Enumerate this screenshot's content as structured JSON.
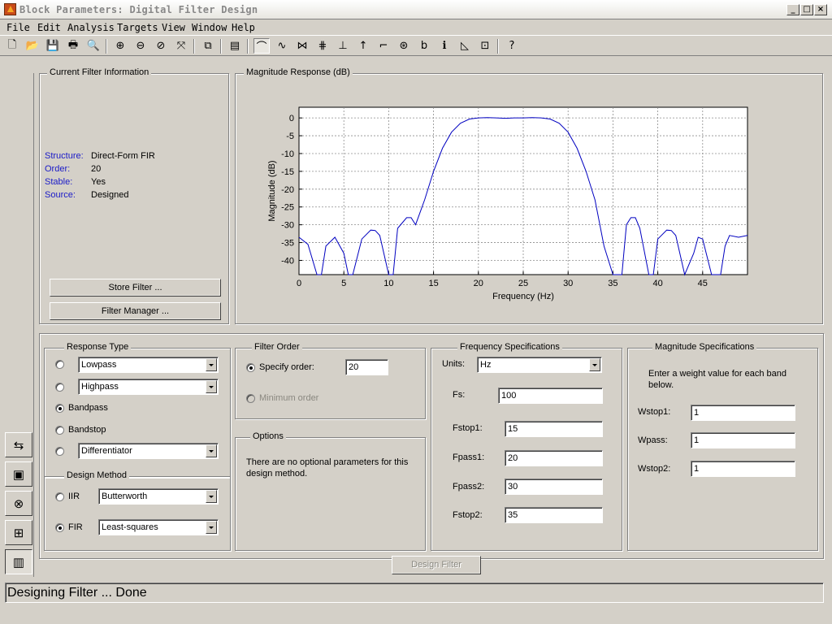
{
  "window": {
    "title": "Block Parameters: Digital Filter Design"
  },
  "menu": [
    "File",
    "Edit",
    "Analysis",
    "Targets",
    "View",
    "Window",
    "Help"
  ],
  "filter_info": {
    "title": "Current Filter Information",
    "structure_label": "Structure:",
    "structure": "Direct-Form FIR",
    "order_label": "Order:",
    "order": "20",
    "stable_label": "Stable:",
    "stable": "Yes",
    "source_label": "Source:",
    "source": "Designed",
    "store_button": "Store Filter ...",
    "manager_button": "Filter Manager ..."
  },
  "response_panel": {
    "title": "Magnitude Response (dB)"
  },
  "chart_data": {
    "type": "line",
    "xlabel": "Frequency (Hz)",
    "ylabel": "Magnitude (dB)",
    "xlim": [
      0,
      50
    ],
    "ylim": [
      -44,
      3
    ],
    "xticks": [
      0,
      5,
      10,
      15,
      20,
      25,
      30,
      35,
      40,
      45
    ],
    "yticks": [
      0,
      -5,
      -10,
      -15,
      -20,
      -25,
      -30,
      -35,
      -40
    ],
    "grid": true,
    "line_color": "#0000c0",
    "series": [
      {
        "x": [
          0,
          1,
          2,
          2.5,
          3,
          4,
          5,
          5.5,
          6,
          7,
          8,
          8.5,
          9,
          10,
          10.5,
          11,
          12,
          12.5,
          13,
          14,
          15,
          16,
          17,
          18,
          19,
          20,
          21,
          22,
          23,
          24,
          25,
          26,
          27,
          28,
          29,
          30,
          31,
          32,
          33,
          34,
          35,
          36,
          36.5,
          37,
          37.5,
          38,
          39,
          39.5,
          40,
          41,
          41.5,
          42,
          43,
          44,
          44.5,
          45,
          46,
          47,
          47.5,
          48,
          49,
          50
        ],
        "y": [
          -33.5,
          -35.5,
          -44,
          -44,
          -36,
          -33.5,
          -38,
          -44,
          -44,
          -34,
          -31.5,
          -31.6,
          -33,
          -44,
          -44,
          -31,
          -28,
          -28,
          -30,
          -23,
          -15,
          -8.5,
          -4,
          -1.5,
          -0.3,
          0,
          0.1,
          0,
          -0.1,
          0,
          0,
          0.1,
          0,
          -0.3,
          -1.5,
          -4,
          -8.5,
          -15,
          -23,
          -36,
          -44,
          -44,
          -30,
          -28,
          -28,
          -31,
          -44,
          -44,
          -34,
          -31.5,
          -31.6,
          -33,
          -44,
          -38,
          -33.5,
          -34,
          -44,
          -44,
          -36,
          -33,
          -33.5,
          -33
        ]
      }
    ]
  },
  "response_type": {
    "title": "Response Type",
    "options": [
      "Lowpass",
      "Highpass",
      "Bandpass",
      "Bandstop",
      "Differentiator"
    ],
    "selected": "Bandpass",
    "lowpass_select": "Lowpass",
    "highpass_select": "Highpass",
    "differentiator_select": "Differentiator"
  },
  "design_method": {
    "title": "Design Method",
    "iir_label": "IIR",
    "iir_select": "Butterworth",
    "fir_label": "FIR",
    "fir_select": "Least-squares",
    "selected": "FIR"
  },
  "filter_order": {
    "title": "Filter Order",
    "specify_label": "Specify order:",
    "specify_value": "20",
    "minimum_label": "Minimum order"
  },
  "options": {
    "title": "Options",
    "text": "There are no optional parameters for this design method."
  },
  "frequency_specs": {
    "title": "Frequency Specifications",
    "units_label": "Units:",
    "units": "Hz",
    "fs_label": "Fs:",
    "fs": "100",
    "fstop1_label": "Fstop1:",
    "fstop1": "15",
    "fpass1_label": "Fpass1:",
    "fpass1": "20",
    "fpass2_label": "Fpass2:",
    "fpass2": "30",
    "fstop2_label": "Fstop2:",
    "fstop2": "35"
  },
  "magnitude_specs": {
    "title": "Magnitude Specifications",
    "instruction": "Enter a weight value for each band below.",
    "wstop1_label": "Wstop1:",
    "wstop1": "1",
    "wpass_label": "Wpass:",
    "wpass": "1",
    "wstop2_label": "Wstop2:",
    "wstop2": "1"
  },
  "design_button": "Design Filter",
  "status": "Designing Filter ... Done"
}
